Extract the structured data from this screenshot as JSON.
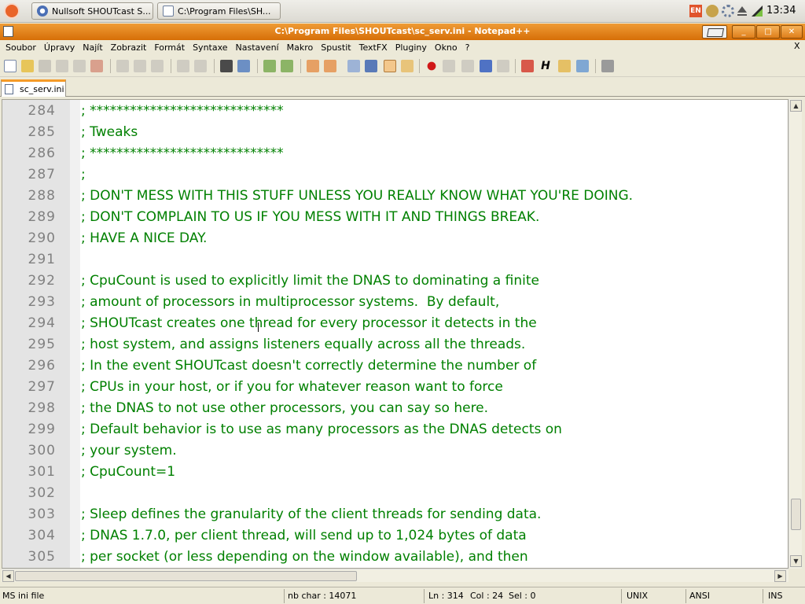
{
  "taskbar": {
    "tasks": [
      "Nullsoft SHOUTcast S...",
      "C:\\Program Files\\SH..."
    ],
    "keyboard_layout": "EN",
    "clock": "13:34"
  },
  "window": {
    "title": "C:\\Program Files\\SHOUTcast\\sc_serv.ini - Notepad++",
    "min": "_",
    "max": "□",
    "close": "✕"
  },
  "menu": {
    "items": [
      "Soubor",
      "Úpravy",
      "Najít",
      "Zobrazit",
      "Formát",
      "Syntaxe",
      "Nastavení",
      "Makro",
      "Spustit",
      "TextFX",
      "Pluginy",
      "Okno",
      "?"
    ],
    "close": "X"
  },
  "tab": {
    "label": "sc_serv.ini"
  },
  "editor": {
    "lines": [
      {
        "n": "284",
        "text": "; *****************************"
      },
      {
        "n": "285",
        "text": "; Tweaks"
      },
      {
        "n": "286",
        "text": "; *****************************"
      },
      {
        "n": "287",
        "text": ";"
      },
      {
        "n": "288",
        "text": "; DON'T MESS WITH THIS STUFF UNLESS YOU REALLY KNOW WHAT YOU'RE DOING."
      },
      {
        "n": "289",
        "text": "; DON'T COMPLAIN TO US IF YOU MESS WITH IT AND THINGS BREAK."
      },
      {
        "n": "290",
        "text": "; HAVE A NICE DAY."
      },
      {
        "n": "291",
        "text": ""
      },
      {
        "n": "292",
        "text": "; CpuCount is used to explicitly limit the DNAS to dominating a finite"
      },
      {
        "n": "293",
        "text": "; amount of processors in multiprocessor systems.  By default,"
      },
      {
        "n": "294",
        "text": "; SHOUTcast creates one thread for every processor it detects in the"
      },
      {
        "n": "295",
        "text": "; host system, and assigns listeners equally across all the threads."
      },
      {
        "n": "296",
        "text": "; In the event SHOUTcast doesn't correctly determine the number of"
      },
      {
        "n": "297",
        "text": "; CPUs in your host, or if you for whatever reason want to force"
      },
      {
        "n": "298",
        "text": "; the DNAS to not use other processors, you can say so here."
      },
      {
        "n": "299",
        "text": "; Default behavior is to use as many processors as the DNAS detects on"
      },
      {
        "n": "300",
        "text": "; your system."
      },
      {
        "n": "301",
        "text": "; CpuCount=1"
      },
      {
        "n": "302",
        "text": ""
      },
      {
        "n": "303",
        "text": "; Sleep defines the granularity of the client threads for sending data."
      },
      {
        "n": "304",
        "text": "; DNAS 1.7.0, per client thread, will send up to 1,024 bytes of data"
      },
      {
        "n": "305",
        "text": "; per socket (or less depending on the window available), and then"
      }
    ]
  },
  "status": {
    "file_type": "MS ini file",
    "char_count": "nb char : 14071",
    "line": "Ln : 314",
    "col": "Col : 24",
    "sel": "Sel : 0",
    "eol": "UNIX",
    "encoding": "ANSI",
    "mode": "INS"
  }
}
